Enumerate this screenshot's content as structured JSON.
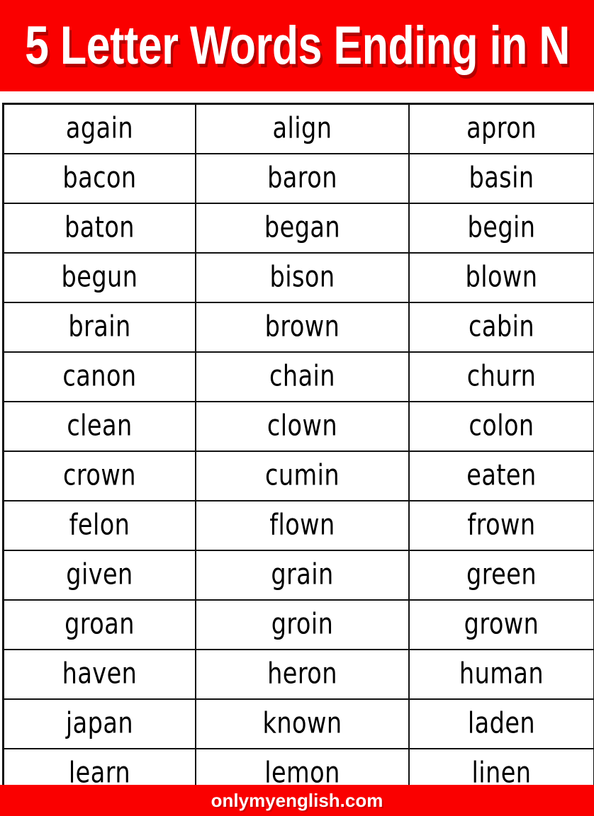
{
  "colors": {
    "banner_red": "#fa0000",
    "text_white": "#ffffff",
    "word_black": "#000000",
    "border_black": "#111111",
    "page_background": "#ffffff"
  },
  "header": {
    "title": "5 Letter Words Ending in N"
  },
  "footer": {
    "site": "onlymyenglish.com"
  },
  "word_table": {
    "column_count": 3,
    "row_count": 14,
    "rows": [
      [
        "again",
        "align",
        "apron"
      ],
      [
        "bacon",
        "baron",
        "basin"
      ],
      [
        "baton",
        "began",
        "begin"
      ],
      [
        "begun",
        "bison",
        "blown"
      ],
      [
        "brain",
        "brown",
        "cabin"
      ],
      [
        "canon",
        "chain",
        "churn"
      ],
      [
        "clean",
        "clown",
        "colon"
      ],
      [
        "crown",
        "cumin",
        "eaten"
      ],
      [
        "felon",
        "flown",
        "frown"
      ],
      [
        "given",
        "grain",
        "green"
      ],
      [
        "groan",
        "groin",
        "grown"
      ],
      [
        "haven",
        "heron",
        "human"
      ],
      [
        "japan",
        "known",
        "laden"
      ],
      [
        "learn",
        "lemon",
        "linen"
      ]
    ]
  }
}
